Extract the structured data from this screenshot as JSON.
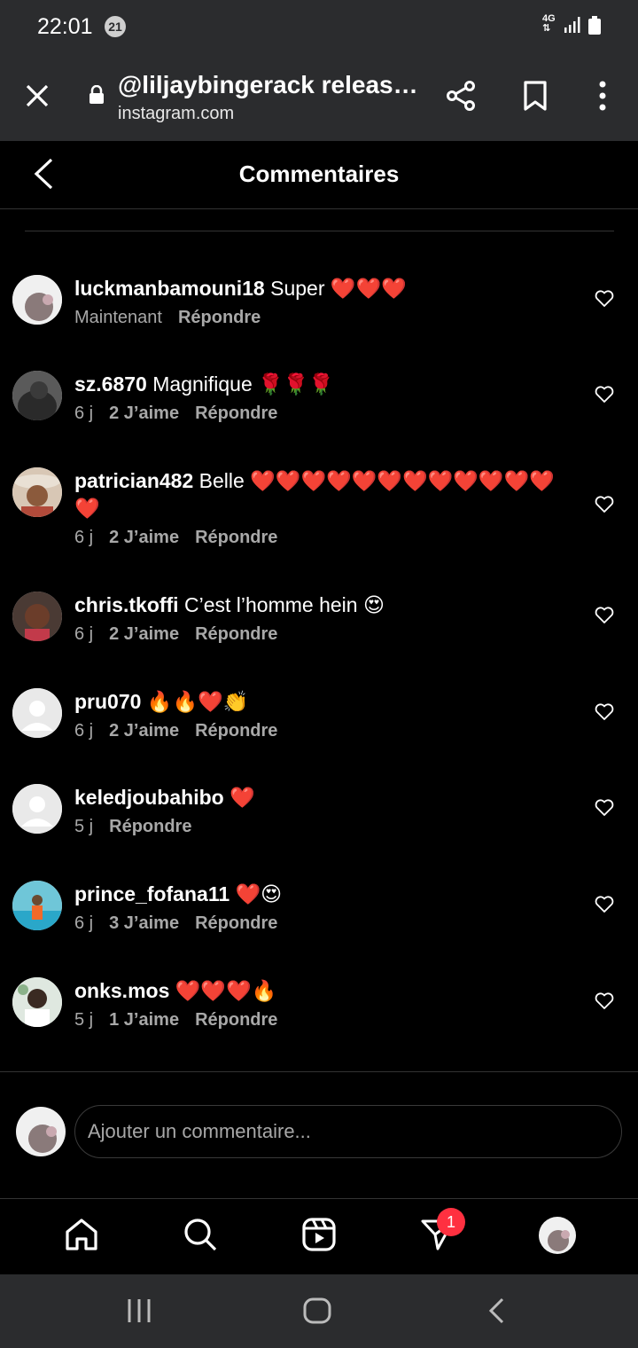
{
  "status": {
    "time": "22:01",
    "notification_count": "21",
    "network": "4G"
  },
  "browser": {
    "title": "@liljaybingerack release…",
    "url": "instagram.com"
  },
  "header": {
    "title": "Commentaires"
  },
  "comments": [
    {
      "user": "luckmanbamouni18",
      "text": "Super ❤️❤️❤️",
      "time": "Maintenant",
      "likes": "",
      "reply": "Répondre"
    },
    {
      "user": "sz.6870",
      "text": "Magnifique 🌹🌹🌹",
      "time": "6 j",
      "likes": "2 J’aime",
      "reply": "Répondre"
    },
    {
      "user": "patrician482",
      "text": "Belle ❤️❤️❤️❤️❤️❤️❤️❤️❤️❤️❤️❤️❤️",
      "time": "6 j",
      "likes": "2 J’aime",
      "reply": "Répondre"
    },
    {
      "user": "chris.tkoffi",
      "text": "C’est l’homme hein 😍",
      "time": "6 j",
      "likes": "2 J’aime",
      "reply": "Répondre"
    },
    {
      "user": "pru070",
      "text": "🔥🔥❤️👏",
      "time": "6 j",
      "likes": "2 J’aime",
      "reply": "Répondre"
    },
    {
      "user": "keledjoubahibo",
      "text": "❤️",
      "time": "5 j",
      "likes": "",
      "reply": "Répondre"
    },
    {
      "user": "prince_fofana11",
      "text": "❤️😍",
      "time": "6 j",
      "likes": "3 J’aime",
      "reply": "Répondre"
    },
    {
      "user": "onks.mos",
      "text": "❤️❤️❤️🔥",
      "time": "5 j",
      "likes": "1 J’aime",
      "reply": "Répondre"
    }
  ],
  "input": {
    "placeholder": "Ajouter un commentaire..."
  },
  "tabbar": {
    "messages_badge": "1"
  },
  "colors": {
    "background": "#000000",
    "chrome": "#2b2c2e",
    "secondary_text": "#a8a8a8",
    "badge": "#ff3040"
  }
}
